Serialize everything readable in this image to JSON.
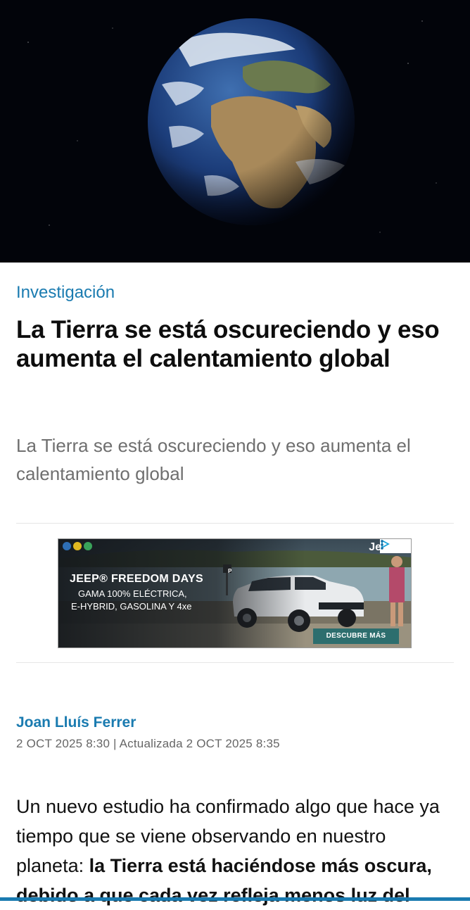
{
  "hero": {
    "image": "earth-from-space"
  },
  "article": {
    "category": "Investigación",
    "headline": "La Tierra se está oscureciendo y eso aumenta el calentamiento global",
    "subtitle": "La Tierra se está oscureciendo y eso aumenta el calentamiento global",
    "author": "Joan Lluís Ferrer",
    "dates": "2 OCT 2025 8:30 | Actualizada 2 OCT 2025 8:35",
    "body_intro": "Un nuevo estudio ha confirmado algo que hace ya tiempo que se viene observando en nuestro planeta: ",
    "body_bold": "la Tierra está haciéndose más oscura, debido a que cada vez refleja menos luz del"
  },
  "ad": {
    "title": "JEEP® FREEDOM DAYS",
    "line1": "GAMA 100% ELÉCTRICA,",
    "line2": "E-HYBRID, GASOLINA Y 4xe",
    "cta": "DESCUBRE MÁS",
    "logo_text": "Je",
    "parking_sign": "P"
  },
  "colors": {
    "accent": "#1a7bb0",
    "ad_cta": "#2d6e6e"
  }
}
